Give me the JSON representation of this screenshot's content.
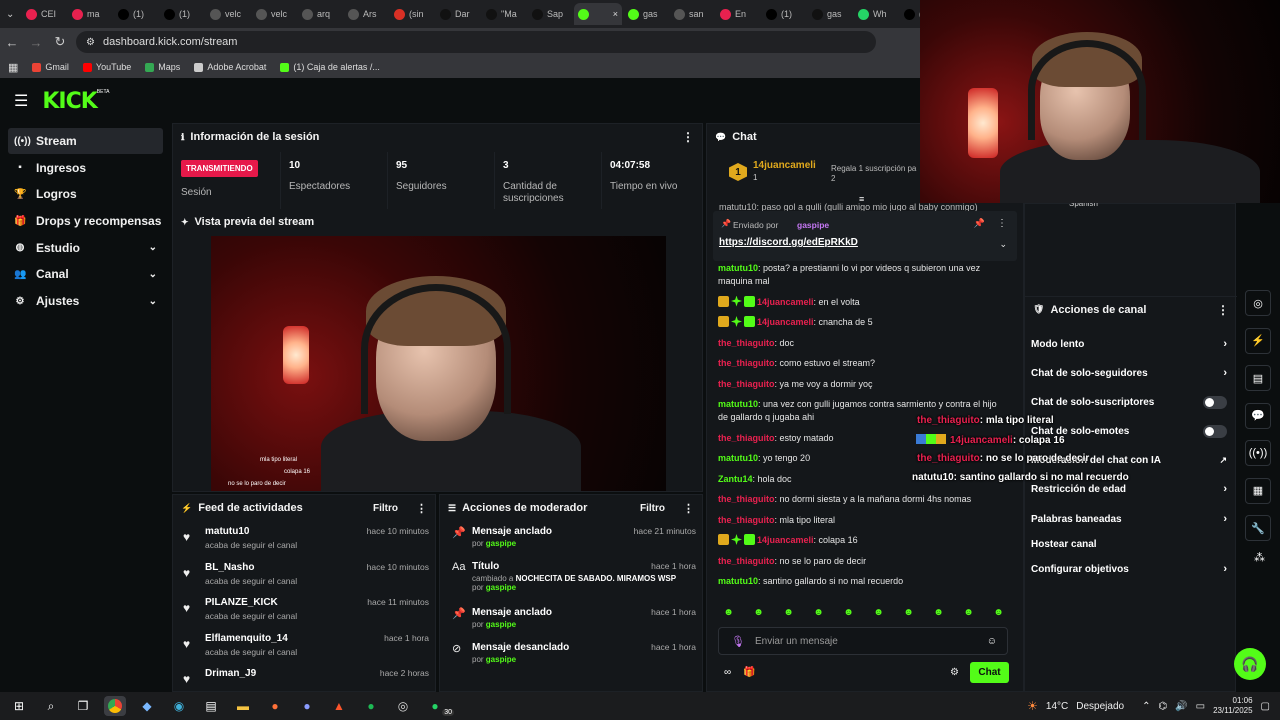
{
  "browser": {
    "tabs": [
      {
        "label": "CEI",
        "color": "#e8214f"
      },
      {
        "label": "ma",
        "color": "#e8214f"
      },
      {
        "label": "(1)",
        "color": "#000000"
      },
      {
        "label": "(1)",
        "color": "#000000"
      },
      {
        "label": "velc",
        "color": "#555555"
      },
      {
        "label": "velc",
        "color": "#555555"
      },
      {
        "label": "arq",
        "color": "#555555"
      },
      {
        "label": "Ars",
        "color": "#555555"
      },
      {
        "label": "(sin",
        "color": "#d93025"
      },
      {
        "label": "Dar",
        "color": "#111111"
      },
      {
        "label": "\"Ma",
        "color": "#111111"
      },
      {
        "label": "Sap",
        "color": "#111111"
      },
      {
        "label": "",
        "color": "#53fc18"
      },
      {
        "label": "gas",
        "color": "#53fc18"
      },
      {
        "label": "san",
        "color": "#555555"
      },
      {
        "label": "En",
        "color": "#e8214f"
      },
      {
        "label": "(1)",
        "color": "#000000"
      },
      {
        "label": "gas",
        "color": "#111111"
      },
      {
        "label": "Wh",
        "color": "#25d366"
      },
      {
        "label": "(1)",
        "color": "#000000"
      }
    ],
    "url": "dashboard.kick.com/stream",
    "bookmarks": [
      {
        "label": "Gmail",
        "icon": "gmail-icon"
      },
      {
        "label": "YouTube",
        "icon": "youtube-icon"
      },
      {
        "label": "Maps",
        "icon": "maps-icon"
      },
      {
        "label": "Adobe Acrobat",
        "icon": "acrobat-icon"
      },
      {
        "label": "(1) Caja de alertas /...",
        "icon": "alerts-icon"
      }
    ]
  },
  "app": {
    "logo": "KICK",
    "logo_sup": "BETA",
    "accent": "#53fc18",
    "sidebar": [
      {
        "label": "Stream",
        "icon": "stream-icon",
        "active": true,
        "chevron": false
      },
      {
        "label": "Ingresos",
        "icon": "revenue-icon",
        "active": false,
        "chevron": false
      },
      {
        "label": "Logros",
        "icon": "trophy-icon",
        "active": false,
        "chevron": false
      },
      {
        "label": "Drops y recompensas",
        "icon": "drops-icon",
        "active": false,
        "chevron": false
      },
      {
        "label": "Estudio",
        "icon": "studio-icon",
        "active": false,
        "chevron": true
      },
      {
        "label": "Canal",
        "icon": "channel-icon",
        "active": false,
        "chevron": true
      },
      {
        "label": "Ajustes",
        "icon": "gear-icon",
        "active": false,
        "chevron": true
      }
    ],
    "session": {
      "title": "Información de la sesión",
      "live_badge": "TRANSMITIENDO",
      "live_label": "Sesión",
      "stats": [
        {
          "value": "10",
          "label": "Espectadores"
        },
        {
          "value": "95",
          "label": "Seguidores"
        },
        {
          "value": "3",
          "label": "Cantidad de suscripciones"
        },
        {
          "value": "04:07:58",
          "label": "Tiempo en vivo"
        }
      ]
    },
    "preview": {
      "title": "Vista previa del stream",
      "overlay_lines": [
        "mla tipo literal",
        "colapa 16",
        "no se lo paro de decir"
      ]
    },
    "activity_feed": {
      "title": "Feed de actividades",
      "filter": "Filtro",
      "items": [
        {
          "name": "matutu10",
          "sub": "acaba de seguir el canal",
          "time": "hace 10 minutos"
        },
        {
          "name": "BL_Nasho",
          "sub": "acaba de seguir el canal",
          "time": "hace 10 minutos"
        },
        {
          "name": "PILANZE_KICK",
          "sub": "acaba de seguir el canal",
          "time": "hace 11 minutos"
        },
        {
          "name": "Elflamenquito_14",
          "sub": "acaba de seguir el canal",
          "time": "hace 1 hora"
        },
        {
          "name": "Driman_J9",
          "sub": "",
          "time": "hace 2 horas"
        }
      ]
    },
    "mod_actions": {
      "title": "Acciones de moderador",
      "filter": "Filtro",
      "items": [
        {
          "name": "Mensaje anclado",
          "pre": "",
          "detail": "",
          "by_prefix": "por",
          "by": "gaspipe",
          "time": "hace 21 minutos",
          "icon": "pin-icon"
        },
        {
          "name": "Título",
          "pre": "cambiado a",
          "detail": "NOCHECITA DE SABADO. MIRAMOS WSP",
          "by_prefix": "por",
          "by": "gaspipe",
          "time": "hace 1 hora",
          "icon": "title-icon"
        },
        {
          "name": "Mensaje anclado",
          "pre": "",
          "detail": "",
          "by_prefix": "por",
          "by": "gaspipe",
          "time": "hace 1 hora",
          "icon": "pin-icon"
        },
        {
          "name": "Mensaje desanclado",
          "pre": "",
          "detail": "",
          "by_prefix": "por",
          "by": "gaspipe",
          "time": "hace 1 hora",
          "icon": "unpin-icon"
        }
      ]
    },
    "chat": {
      "title": "Chat",
      "top_gifter": {
        "rank": "1",
        "name": "14juancameli",
        "count": "1",
        "gift_text": "Regala 1 suscripción pa",
        "gift_count": "2"
      },
      "partial_line": "matutu10: paso gol a gulli (gulli amigo mio jugo al baby conmigo)",
      "pinned": {
        "label": "Enviado por",
        "by": "gaspipe",
        "link": "https://discord.gg/edEpRKkD"
      },
      "messages": [
        {
          "user": "matutu10",
          "color": "green",
          "badges": false,
          "text": "posta? a prestianni lo vi por videos q subieron una vez maquina mal"
        },
        {
          "user": "14juancameli",
          "color": "red",
          "badges": true,
          "text": "en el volta"
        },
        {
          "user": "14juancameli",
          "color": "red",
          "badges": true,
          "text": "cnancha de 5"
        },
        {
          "user": "the_thiaguito",
          "color": "red",
          "badges": false,
          "text": "doc"
        },
        {
          "user": "the_thiaguito",
          "color": "red",
          "badges": false,
          "text": "como estuvo el stream?"
        },
        {
          "user": "the_thiaguito",
          "color": "red",
          "badges": false,
          "text": "ya me voy a dormir yoç"
        },
        {
          "user": "matutu10",
          "color": "green",
          "badges": false,
          "text": "una vez con gulli jugamos contra sarmiento y contra el hijo de gallardo q jugaba ahi"
        },
        {
          "user": "the_thiaguito",
          "color": "red",
          "badges": false,
          "text": "estoy matado"
        },
        {
          "user": "matutu10",
          "color": "green",
          "badges": false,
          "text": "yo tengo 20"
        },
        {
          "user": "Zantu14",
          "color": "green",
          "badges": false,
          "text": "hola doc"
        },
        {
          "user": "the_thiaguito",
          "color": "red",
          "badges": false,
          "text": "no dormi siesta y a la mañana dormi 4hs nomas"
        },
        {
          "user": "the_thiaguito",
          "color": "red",
          "badges": false,
          "text": "mla tipo literal"
        },
        {
          "user": "14juancameli",
          "color": "red",
          "badges": true,
          "text": "colapa 16"
        },
        {
          "user": "the_thiaguito",
          "color": "red",
          "badges": false,
          "text": "no se lo paro de decir"
        },
        {
          "user": "matutu10",
          "color": "green",
          "badges": false,
          "text": "santino gallardo si no mal recuerdo"
        }
      ],
      "input_placeholder": "Enviar un mensaje",
      "send_label": "Chat"
    },
    "channel_actions": {
      "title": "Acciones de canal",
      "language": "Spanish",
      "items": [
        {
          "label": "Modo lento",
          "kind": "chevron"
        },
        {
          "label": "Chat de solo-seguidores",
          "kind": "chevron"
        },
        {
          "label": "Chat de solo-suscriptores",
          "kind": "toggle"
        },
        {
          "label": "Chat de solo-emotes",
          "kind": "toggle"
        },
        {
          "label": "Moderación del chat con IA",
          "kind": "external"
        },
        {
          "label": "Restricción de edad",
          "kind": "chevron"
        },
        {
          "label": "Palabras baneadas",
          "kind": "chevron"
        },
        {
          "label": "Hostear canal",
          "kind": "none"
        },
        {
          "label": "Configurar objetivos",
          "kind": "chevron"
        }
      ]
    },
    "overlay_chat": [
      {
        "user": "the_thiaguito",
        "text": ": mla tipo literal"
      },
      {
        "user": "14juancameli",
        "text": ": colapa 16"
      },
      {
        "user": "the_thiaguito",
        "text": ": no se lo paro de decir"
      },
      {
        "user": "natutu10",
        "text": ": santino gallardo si no mal recuerdo"
      }
    ]
  },
  "taskbar": {
    "temp": "14°C",
    "weather": "Despejado",
    "time": "01:06",
    "date": "23/11/2025",
    "badge": "30"
  }
}
